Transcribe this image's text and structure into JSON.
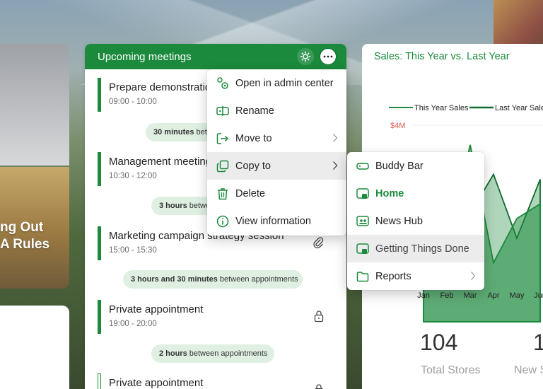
{
  "left_card": {
    "caption_line1": "ng Out",
    "caption_line2": "A Rules"
  },
  "meetings": {
    "title": "Upcoming meetings",
    "items": [
      {
        "title": "Prepare demonstration",
        "time": "09:00 - 10:00"
      },
      {
        "title": "Management meeting",
        "time": "10:30 - 12:00"
      },
      {
        "title": "Marketing campaign strategy session",
        "time": "15:00 - 15:30"
      },
      {
        "title": "Private appointment",
        "time": "19:00 - 20:00"
      },
      {
        "title": "Private appointment",
        "time": ""
      }
    ],
    "gaps": [
      {
        "bold": "30 minutes",
        "text": "between appointments"
      },
      {
        "bold": "3 hours",
        "text": "between appointments"
      },
      {
        "bold": "3 hours and 30 minutes",
        "text": "between appointments"
      },
      {
        "bold": "2 hours",
        "text": "between appointments"
      }
    ]
  },
  "context_menu": {
    "items": [
      {
        "label": "Open in admin center",
        "icon": "admin-center-icon"
      },
      {
        "label": "Rename",
        "icon": "rename-icon"
      },
      {
        "label": "Move to",
        "icon": "move-to-icon"
      },
      {
        "label": "Copy to",
        "icon": "copy-icon"
      },
      {
        "label": "Delete",
        "icon": "trash-icon"
      },
      {
        "label": "View information",
        "icon": "info-icon"
      }
    ]
  },
  "submenu": {
    "items": [
      {
        "label": "Buddy Bar",
        "icon": "bar-icon"
      },
      {
        "label": "Home",
        "icon": "page-icon"
      },
      {
        "label": "News Hub",
        "icon": "page-icon"
      },
      {
        "label": "Getting Things Done",
        "icon": "page-icon"
      },
      {
        "label": "Reports",
        "icon": "folder-icon"
      }
    ]
  },
  "sales": {
    "title": "Sales: This Year vs. Last Year",
    "legend": [
      "This Year Sales",
      "Last Year Sale"
    ],
    "y_label": "$4M",
    "months": [
      "Jan",
      "Feb",
      "Mar",
      "Apr",
      "May",
      "Jun"
    ],
    "stats": [
      {
        "value": "104",
        "label": "Total Stores"
      },
      {
        "value": "1",
        "label": "New S"
      }
    ]
  },
  "colors": {
    "accent": "#1b8a3c",
    "gap_pill": "#dff0e3"
  },
  "chart_data": {
    "type": "area",
    "title": "Sales: This Year vs. Last Year",
    "categories": [
      "Jan",
      "Feb",
      "Mar",
      "Apr",
      "May",
      "Jun"
    ],
    "series": [
      {
        "name": "This Year Sales",
        "values": [
          1.1,
          1.6,
          3.6,
          1.2,
          2.1,
          2.4
        ]
      },
      {
        "name": "Last Year Sale",
        "values": [
          0.9,
          1.3,
          2.2,
          3.0,
          1.7,
          2.9
        ]
      }
    ],
    "ylabel": "",
    "ylim": [
      0,
      4
    ],
    "grid": true,
    "legend_position": "top"
  }
}
